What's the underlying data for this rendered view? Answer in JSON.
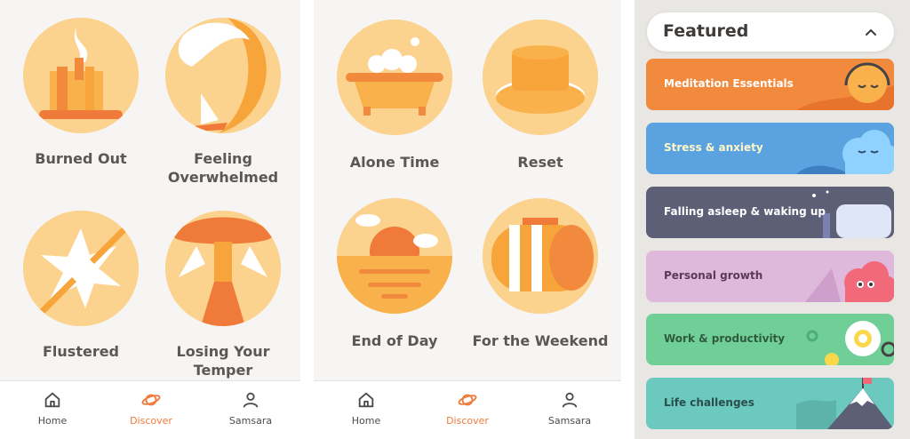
{
  "panel_a": {
    "tiles": [
      {
        "label": "Burned Out"
      },
      {
        "label": "Feeling Overwhelmed"
      },
      {
        "label": "Flustered"
      },
      {
        "label": "Losing Your Temper"
      }
    ]
  },
  "panel_b": {
    "tiles": [
      {
        "label": "Alone Time"
      },
      {
        "label": "Reset"
      },
      {
        "label": "End of Day"
      },
      {
        "label": "For the Weekend"
      }
    ]
  },
  "nav": {
    "home": "Home",
    "discover": "Discover",
    "profile": "Samsara",
    "active": "discover"
  },
  "featured": {
    "title": "Featured",
    "categories": [
      {
        "label": "Meditation Essentials",
        "color": "#f28a3e",
        "icon": "headphones-face"
      },
      {
        "label": "Stress & anxiety",
        "color": "#5aa3e0",
        "icon": "cloud-face"
      },
      {
        "label": "Falling asleep & waking up",
        "color": "#5c5f76",
        "icon": "pillow"
      },
      {
        "label": "Personal growth",
        "color": "#dfb9dc",
        "icon": "pink-cloud"
      },
      {
        "label": "Work & productivity",
        "color": "#6fcf97",
        "icon": "gear"
      },
      {
        "label": "Life challenges",
        "color": "#6cc9c0",
        "icon": "mountain-flag"
      }
    ]
  },
  "colors": {
    "accent": "#f07a3a",
    "tile_circle": "#fcd38e",
    "tile_label": "#5b5755"
  }
}
